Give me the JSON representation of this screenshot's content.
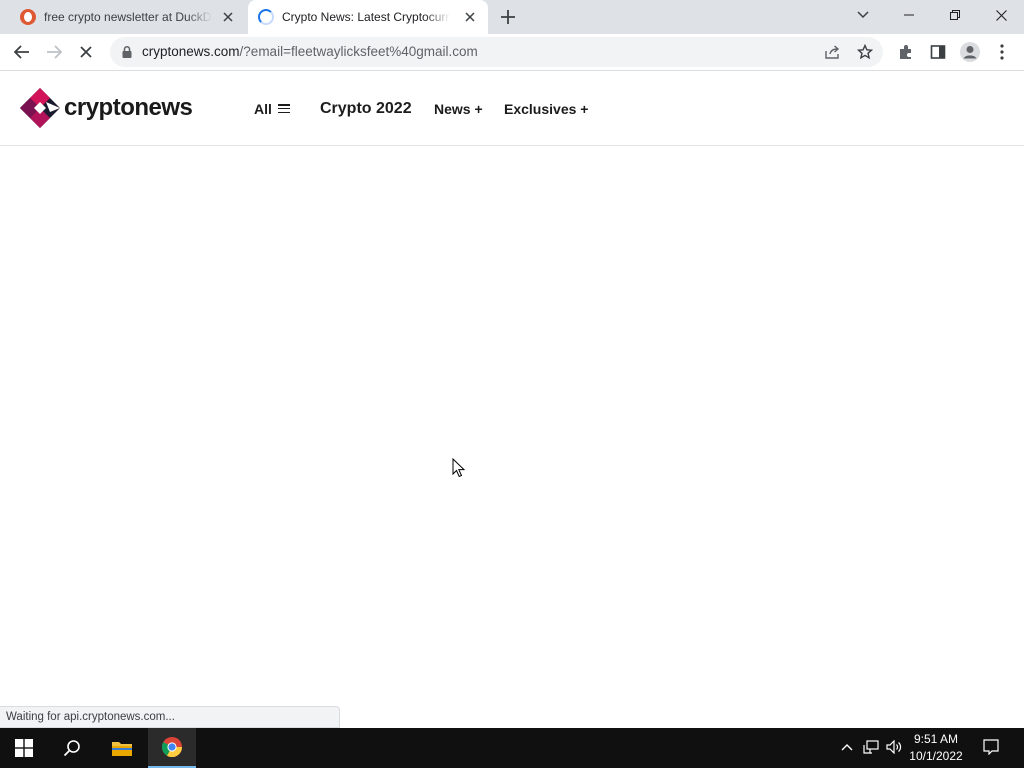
{
  "browser": {
    "tabs": [
      {
        "title": "free crypto newsletter at DuckDuckGo",
        "favicon": "duckduckgo-icon",
        "active": false
      },
      {
        "title": "Crypto News: Latest Cryptocurrency News",
        "favicon": "loading-spinner-icon",
        "active": true
      }
    ],
    "address": {
      "host": "cryptonews.com",
      "path": "/?email=fleetwaylicksfeet%40gmail.com"
    },
    "status_text": "Waiting for api.cryptonews.com..."
  },
  "site": {
    "logo_text": "cryptonews",
    "nav": {
      "all": "All",
      "crypto": "Crypto 2022",
      "news": "News +",
      "exclusives": "Exclusives +"
    }
  },
  "taskbar": {
    "time": "9:51 AM",
    "date": "10/1/2022"
  },
  "colors": {
    "tabstrip": "#dee1e6",
    "omnibox": "#f1f3f4",
    "taskbar": "#101010",
    "logo_magenta": "#b0135a",
    "logo_dark": "#1b1b2f"
  }
}
